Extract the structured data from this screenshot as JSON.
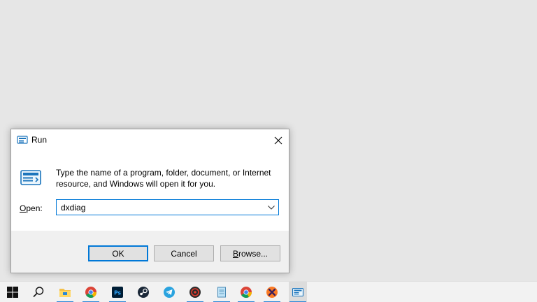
{
  "dialog": {
    "title": "Run",
    "message": "Type the name of a program, folder, document, or Internet resource, and Windows will open it for you.",
    "open_label_accel": "O",
    "open_label_rest": "pen:",
    "input_value": "dxdiag",
    "ok_label": "OK",
    "cancel_label": "Cancel",
    "browse_label_accel": "B",
    "browse_label_rest": "rowse..."
  },
  "taskbar": {
    "items": [
      {
        "icon": "windows-start-icon"
      },
      {
        "icon": "search-icon"
      },
      {
        "icon": "file-explorer-icon",
        "running": true
      },
      {
        "icon": "chrome-icon",
        "running": true
      },
      {
        "icon": "photoshop-icon",
        "label": "Ps",
        "running": true
      },
      {
        "icon": "steam-icon"
      },
      {
        "icon": "telegram-icon"
      },
      {
        "icon": "media-player-icon",
        "running": true
      },
      {
        "icon": "notepad-icon",
        "running": true
      },
      {
        "icon": "chrome-icon",
        "running": true
      },
      {
        "icon": "xampp-icon",
        "running": true
      },
      {
        "icon": "run-app-icon",
        "running": true,
        "active": true
      }
    ]
  },
  "colors": {
    "desktop": "#e6e6e6",
    "accent": "#0078d7",
    "taskbar": "#f2f2f2"
  }
}
